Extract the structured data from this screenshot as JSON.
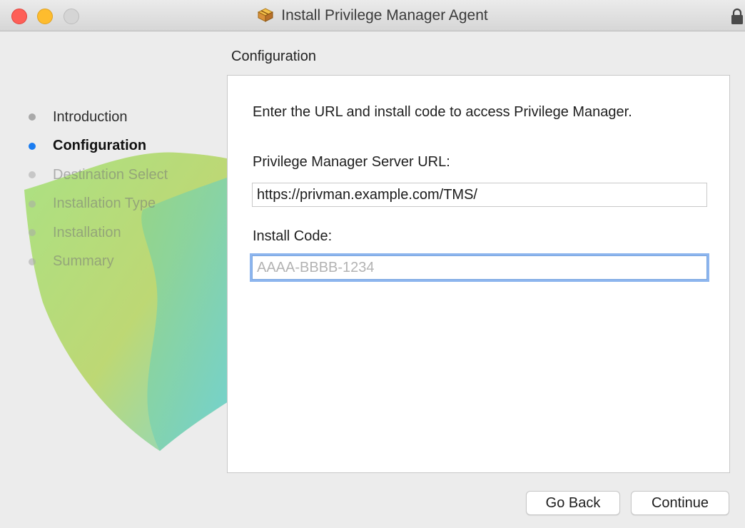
{
  "window": {
    "title": "Install Privilege Manager Agent",
    "icon": "package-installer-icon",
    "lock_icon": "lock-icon"
  },
  "section_title": "Configuration",
  "sidebar": {
    "steps": [
      {
        "label": "Introduction",
        "state": "done"
      },
      {
        "label": "Configuration",
        "state": "current"
      },
      {
        "label": "Destination Select",
        "state": "pending"
      },
      {
        "label": "Installation Type",
        "state": "pending"
      },
      {
        "label": "Installation",
        "state": "pending"
      },
      {
        "label": "Summary",
        "state": "pending"
      }
    ]
  },
  "content": {
    "intro": "Enter the URL and install code to access Privilege Manager.",
    "server_url_label": "Privilege Manager Server URL:",
    "server_url_value": "https://privman.example.com/TMS/",
    "install_code_label": "Install Code:",
    "install_code_value": "",
    "install_code_placeholder": "AAAA-BBBB-1234"
  },
  "buttons": {
    "back": "Go Back",
    "continue": "Continue"
  },
  "colors": {
    "current_step_dot": "#1a7cf0",
    "focus_ring": "#8db5ee"
  }
}
